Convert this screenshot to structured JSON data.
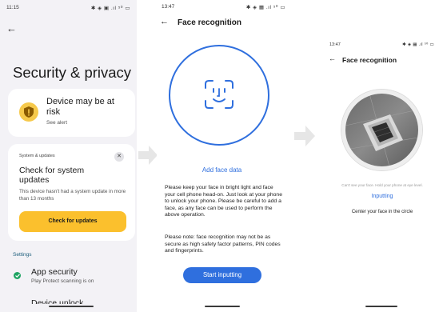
{
  "colors": {
    "accent": "#2f6fde",
    "warning": "#fbc02d",
    "ok": "#1fa463"
  },
  "panel1": {
    "status": {
      "time": "11:15",
      "icons": "✱ ◈ ▣ .ıl ⁵⁰ ▭"
    },
    "back_icon": "back-arrow-icon",
    "title": "Security & privacy",
    "risk_card": {
      "heading": "Device may be at risk",
      "sub": "See alert",
      "icon": "warning-shield-icon"
    },
    "update_card": {
      "category": "System & updates",
      "close": "✕",
      "heading": "Check for system updates",
      "description": "This device hasn't had a system update in more than 13 months",
      "button": "Check for updates"
    },
    "section": "Settings",
    "app_security": {
      "title": "App security",
      "sub": "Play Protect scanning is on",
      "icon": "check-circle-icon"
    },
    "device_unlock": "Device unlock"
  },
  "panel2": {
    "status": {
      "time": "13:47",
      "icons": "✱ ◈ ▦ .ıl ⁵⁰ ▭"
    },
    "back_icon": "back-arrow-icon",
    "title": "Face recognition",
    "add_face": "Add face data",
    "description": "Please keep your face in bright light and face your cell phone head-on. Just look at your phone to unlock your phone. Please be careful to add a face, as any face can be used to perform the above operation.",
    "note": "Please note: face recognition may not be as secure as high safety factor patterns, PIN codes and fingerprints.",
    "button": "Start inputting"
  },
  "panel3": {
    "status": {
      "time": "13:47",
      "icons": "✱ ◈ ▦ .ıl ⁵⁰ ▭"
    },
    "back_icon": "back-arrow-icon",
    "title": "Face recognition",
    "warning": "Can't see your face. Hold your phone at eye level.",
    "state": "Inputting",
    "instruction": "Center your face in the circle"
  }
}
